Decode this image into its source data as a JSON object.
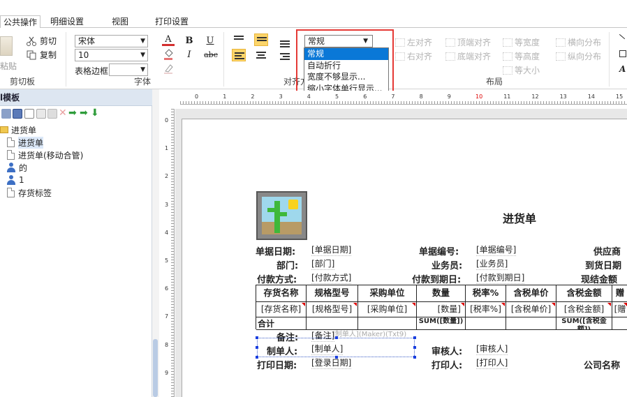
{
  "tabs": [
    "公共操作",
    "明细设置",
    "视图",
    "打印设置"
  ],
  "ribbon": {
    "clipboard": {
      "paste": "粘贴",
      "cut": "剪切",
      "copy": "复制",
      "group": "剪切板"
    },
    "font": {
      "name": "宋体",
      "size": "10",
      "border_label": "表格边框",
      "border_value": "",
      "group": "字体",
      "font_color_glyph": "A",
      "bold": "B",
      "italic": "I",
      "underline": "U",
      "strike": "abc"
    },
    "align": {
      "group": "对齐方式",
      "group_visible": "对齐方"
    },
    "wrap_combo": {
      "value": "常规",
      "options": [
        "常规",
        "自动折行",
        "宽度不够显示...",
        "缩小字体单行显示..."
      ]
    },
    "layout": {
      "group": "布局",
      "buttons": [
        "左对齐",
        "右对齐",
        "顶端对齐",
        "底端对齐",
        "等宽度",
        "等高度",
        "等大小",
        "横向分布",
        "纵向分布"
      ]
    }
  },
  "left_panel": {
    "title": "l模板",
    "tree": [
      {
        "label": "进货单",
        "type": "folder",
        "level": 0
      },
      {
        "label": "进货单",
        "type": "doc",
        "level": 1,
        "selected": true
      },
      {
        "label": "进货单(移动合管)",
        "type": "doc",
        "level": 1
      },
      {
        "label": "的",
        "type": "user",
        "level": 1
      },
      {
        "label": "1",
        "type": "user",
        "level": 1
      },
      {
        "label": "存货标签",
        "type": "doc",
        "level": 1
      }
    ]
  },
  "ruler": {
    "h": [
      "0",
      "1",
      "2",
      "3",
      "4",
      "5",
      "6",
      "7",
      "8",
      "9",
      "10",
      "11",
      "12",
      "13",
      "14",
      "15"
    ],
    "v": [
      "0",
      "1",
      "2",
      "3",
      "4",
      "5",
      "6",
      "7",
      "8",
      "9"
    ],
    "red_index": 10,
    "accent_red": "#dd0000"
  },
  "report": {
    "title": "进货单",
    "rows": [
      {
        "l1": "单据日期:",
        "f1": "[单据日期]",
        "l2": "单据编号:",
        "f2": "[单据编号]",
        "l3": "供应商"
      },
      {
        "l1": "部门:",
        "f1": "[部门]",
        "l2": "业务员:",
        "f2": "[业务员]",
        "l3": "到货日期"
      },
      {
        "l1": "付款方式:",
        "f1": "[付款方式]",
        "l2": "付款到期日:",
        "f2": "[付款到期日]",
        "l3": "现结金额"
      }
    ],
    "table": {
      "headers": [
        "存货名称",
        "规格型号",
        "采购单位",
        "数量",
        "税率%",
        "含税单价",
        "含税金额",
        "赠"
      ],
      "data": [
        "[存货名称]",
        "[规格型号]",
        "[采购单位]",
        "[数量]",
        "[税率%]",
        "[含税单价]",
        "[含税金额]",
        "[赠"
      ],
      "footer": [
        "合计",
        "",
        "",
        "SUM([数量])",
        "",
        "",
        "SUM([含税金额])",
        ""
      ]
    },
    "ghost": "[制单人](Maker)(Txt9)",
    "bottom": [
      {
        "l1": "备注:",
        "f1": "[备注]"
      },
      {
        "l1": "制单人:",
        "f1": "[制单人]",
        "l2": "审核人:",
        "f2": "[审核人]"
      },
      {
        "l1": "打印日期:",
        "f1": "[登录日期]",
        "l2": "打印人:",
        "f2": "[打印人]",
        "l3": "公司名称"
      }
    ]
  }
}
